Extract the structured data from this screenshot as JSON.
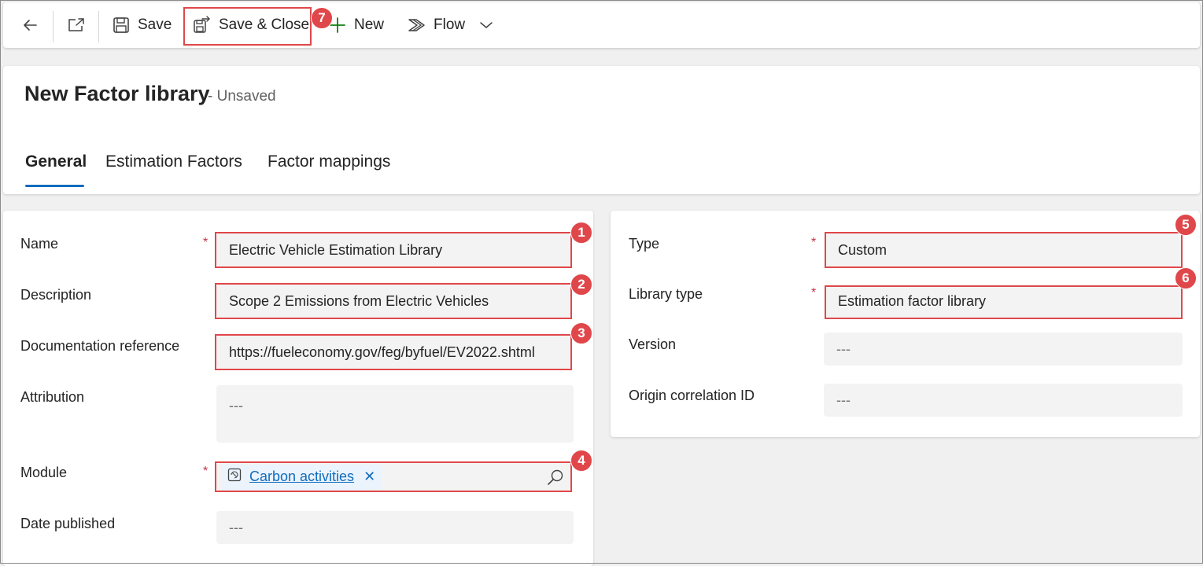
{
  "toolbar": {
    "back_icon": "arrow-left-icon",
    "popout_icon": "open-in-new-window-icon",
    "save_label": "Save",
    "save_close_label": "Save & Close",
    "new_label": "New",
    "flow_label": "Flow"
  },
  "header": {
    "title": "New Factor library",
    "status": "- Unsaved"
  },
  "tabs": [
    {
      "label": "General",
      "active": true
    },
    {
      "label": "Estimation Factors",
      "active": false
    },
    {
      "label": "Factor mappings",
      "active": false
    }
  ],
  "left_section": {
    "name": {
      "label": "Name",
      "required": "*",
      "value": "Electric Vehicle Estimation Library"
    },
    "description": {
      "label": "Description",
      "value": "Scope 2 Emissions from Electric Vehicles"
    },
    "documentation_reference": {
      "label": "Documentation reference",
      "value": "https://fueleconomy.gov/feg/byfuel/EV2022.shtml"
    },
    "attribution": {
      "label": "Attribution",
      "value": "---"
    },
    "module": {
      "label": "Module",
      "required": "*",
      "tag": "Carbon activities",
      "remove": "✕"
    },
    "date_published": {
      "label": "Date published",
      "value": "---"
    }
  },
  "right_section": {
    "type": {
      "label": "Type",
      "required": "*",
      "value": "Custom"
    },
    "library_type": {
      "label": "Library type",
      "required": "*",
      "value": "Estimation factor library"
    },
    "version": {
      "label": "Version",
      "value": "---"
    },
    "origin_correlation_id": {
      "label": "Origin correlation ID",
      "value": "---"
    }
  },
  "callouts": [
    "1",
    "2",
    "3",
    "4",
    "5",
    "6",
    "7"
  ],
  "colors": {
    "accent": "#0f6cbd",
    "callout": "#e0474a",
    "new_plus": "#107c10",
    "required": "#c4314b"
  }
}
